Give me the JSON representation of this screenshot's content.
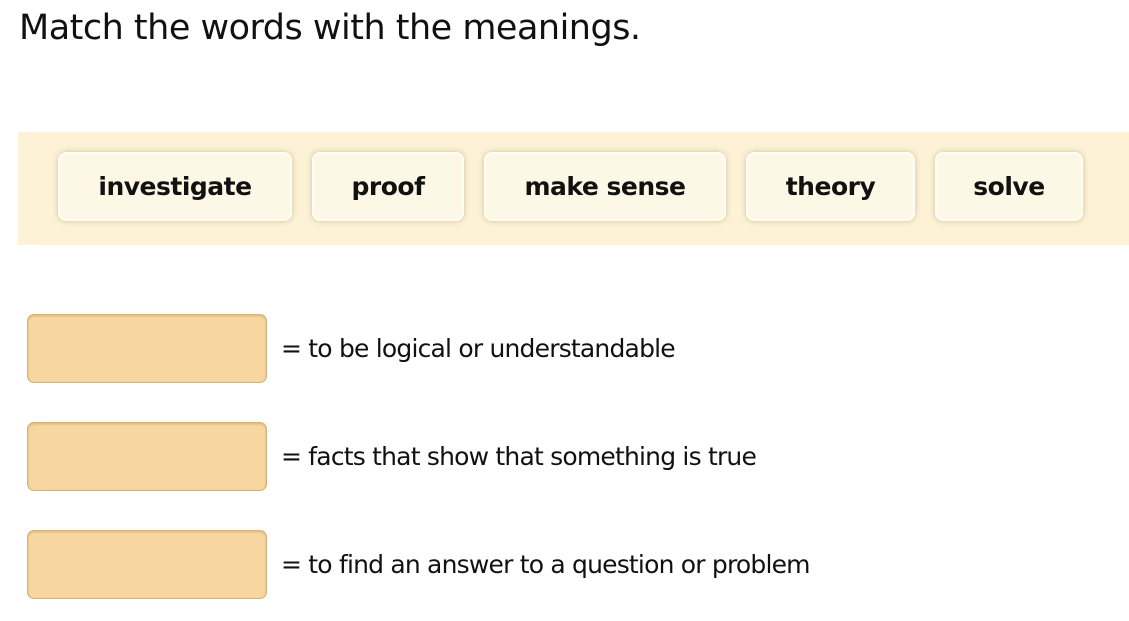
{
  "instruction": "Match the words with the meanings.",
  "colors": {
    "word_bank_background": "#fdf2d6",
    "chip_background": "#fdf7e6",
    "answer_slot_background": "#f8d69f"
  },
  "word_bank": [
    {
      "label": "investigate"
    },
    {
      "label": "proof"
    },
    {
      "label": "make sense"
    },
    {
      "label": "theory"
    },
    {
      "label": "solve"
    }
  ],
  "meanings": [
    {
      "answer": "",
      "text": "= to be logical or understandable"
    },
    {
      "answer": "",
      "text": "= facts that show that something is true"
    },
    {
      "answer": "",
      "text": "= to find an answer to a question or problem"
    }
  ]
}
